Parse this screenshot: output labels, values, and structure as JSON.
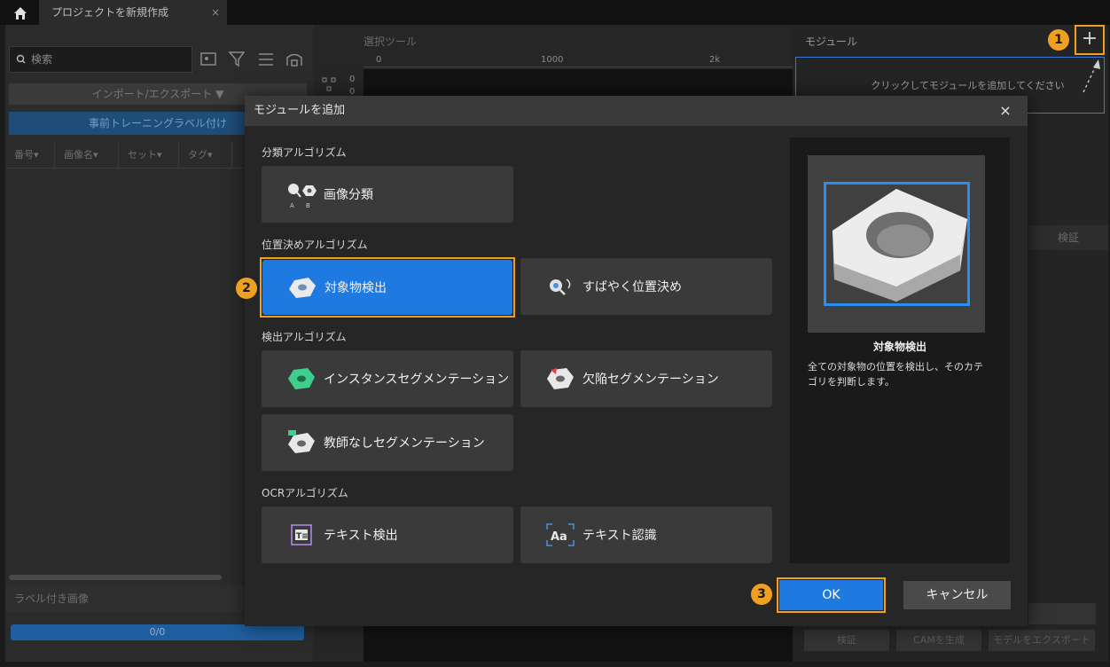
{
  "titlebar": {
    "tab_label": "プロジェクトを新規作成",
    "tab_close": "×"
  },
  "left_panel": {
    "search_placeholder": "検索",
    "import_export": "インポート/エクスポート ▼",
    "pretrain_label": "事前トレーニングラベル付け",
    "columns": [
      "番号▾",
      "画像名▾",
      "セット▾",
      "タグ▾"
    ],
    "labeled_images": "ラベル付き画像",
    "progress_text": "0/0",
    "progress_fraction": 1.0
  },
  "center": {
    "tool_label": "選択ツール",
    "ruler_ticks": [
      "0",
      "1000",
      "2k"
    ],
    "side_values": [
      "0",
      "0"
    ]
  },
  "right_panel": {
    "title": "モジュール",
    "add_symbol": "+",
    "dropzone_text": "クリックしてモジュールを追加してください",
    "verify_tab": "検証",
    "bottom_buttons": [
      "検証",
      "CAMを生成",
      "モデルをエクスポート"
    ]
  },
  "badges": [
    "1",
    "2",
    "3"
  ],
  "dialog": {
    "title": "モジュールを追加",
    "close": "×",
    "sections": [
      {
        "label": "分類アルゴリズム",
        "cards": [
          "画像分類"
        ]
      },
      {
        "label": "位置決めアルゴリズム",
        "cards": [
          "対象物検出",
          "すばやく位置決め"
        ]
      },
      {
        "label": "検出アルゴリズム",
        "cards": [
          "インスタンスセグメンテーション",
          "欠陥セグメンテーション",
          "教師なしセグメンテーション"
        ]
      },
      {
        "label": "OCRアルゴリズム",
        "cards": [
          "テキスト検出",
          "テキスト認識"
        ]
      }
    ],
    "selected": "対象物検出",
    "preview_title": "対象物検出",
    "preview_desc": "全ての対象物の位置を検出し、そのカテゴリを判断します。",
    "ok": "OK",
    "cancel": "キャンセル"
  },
  "colors": {
    "accent": "#1e7ae0",
    "highlight": "#f0a020",
    "dialog_bg": "#262626"
  }
}
